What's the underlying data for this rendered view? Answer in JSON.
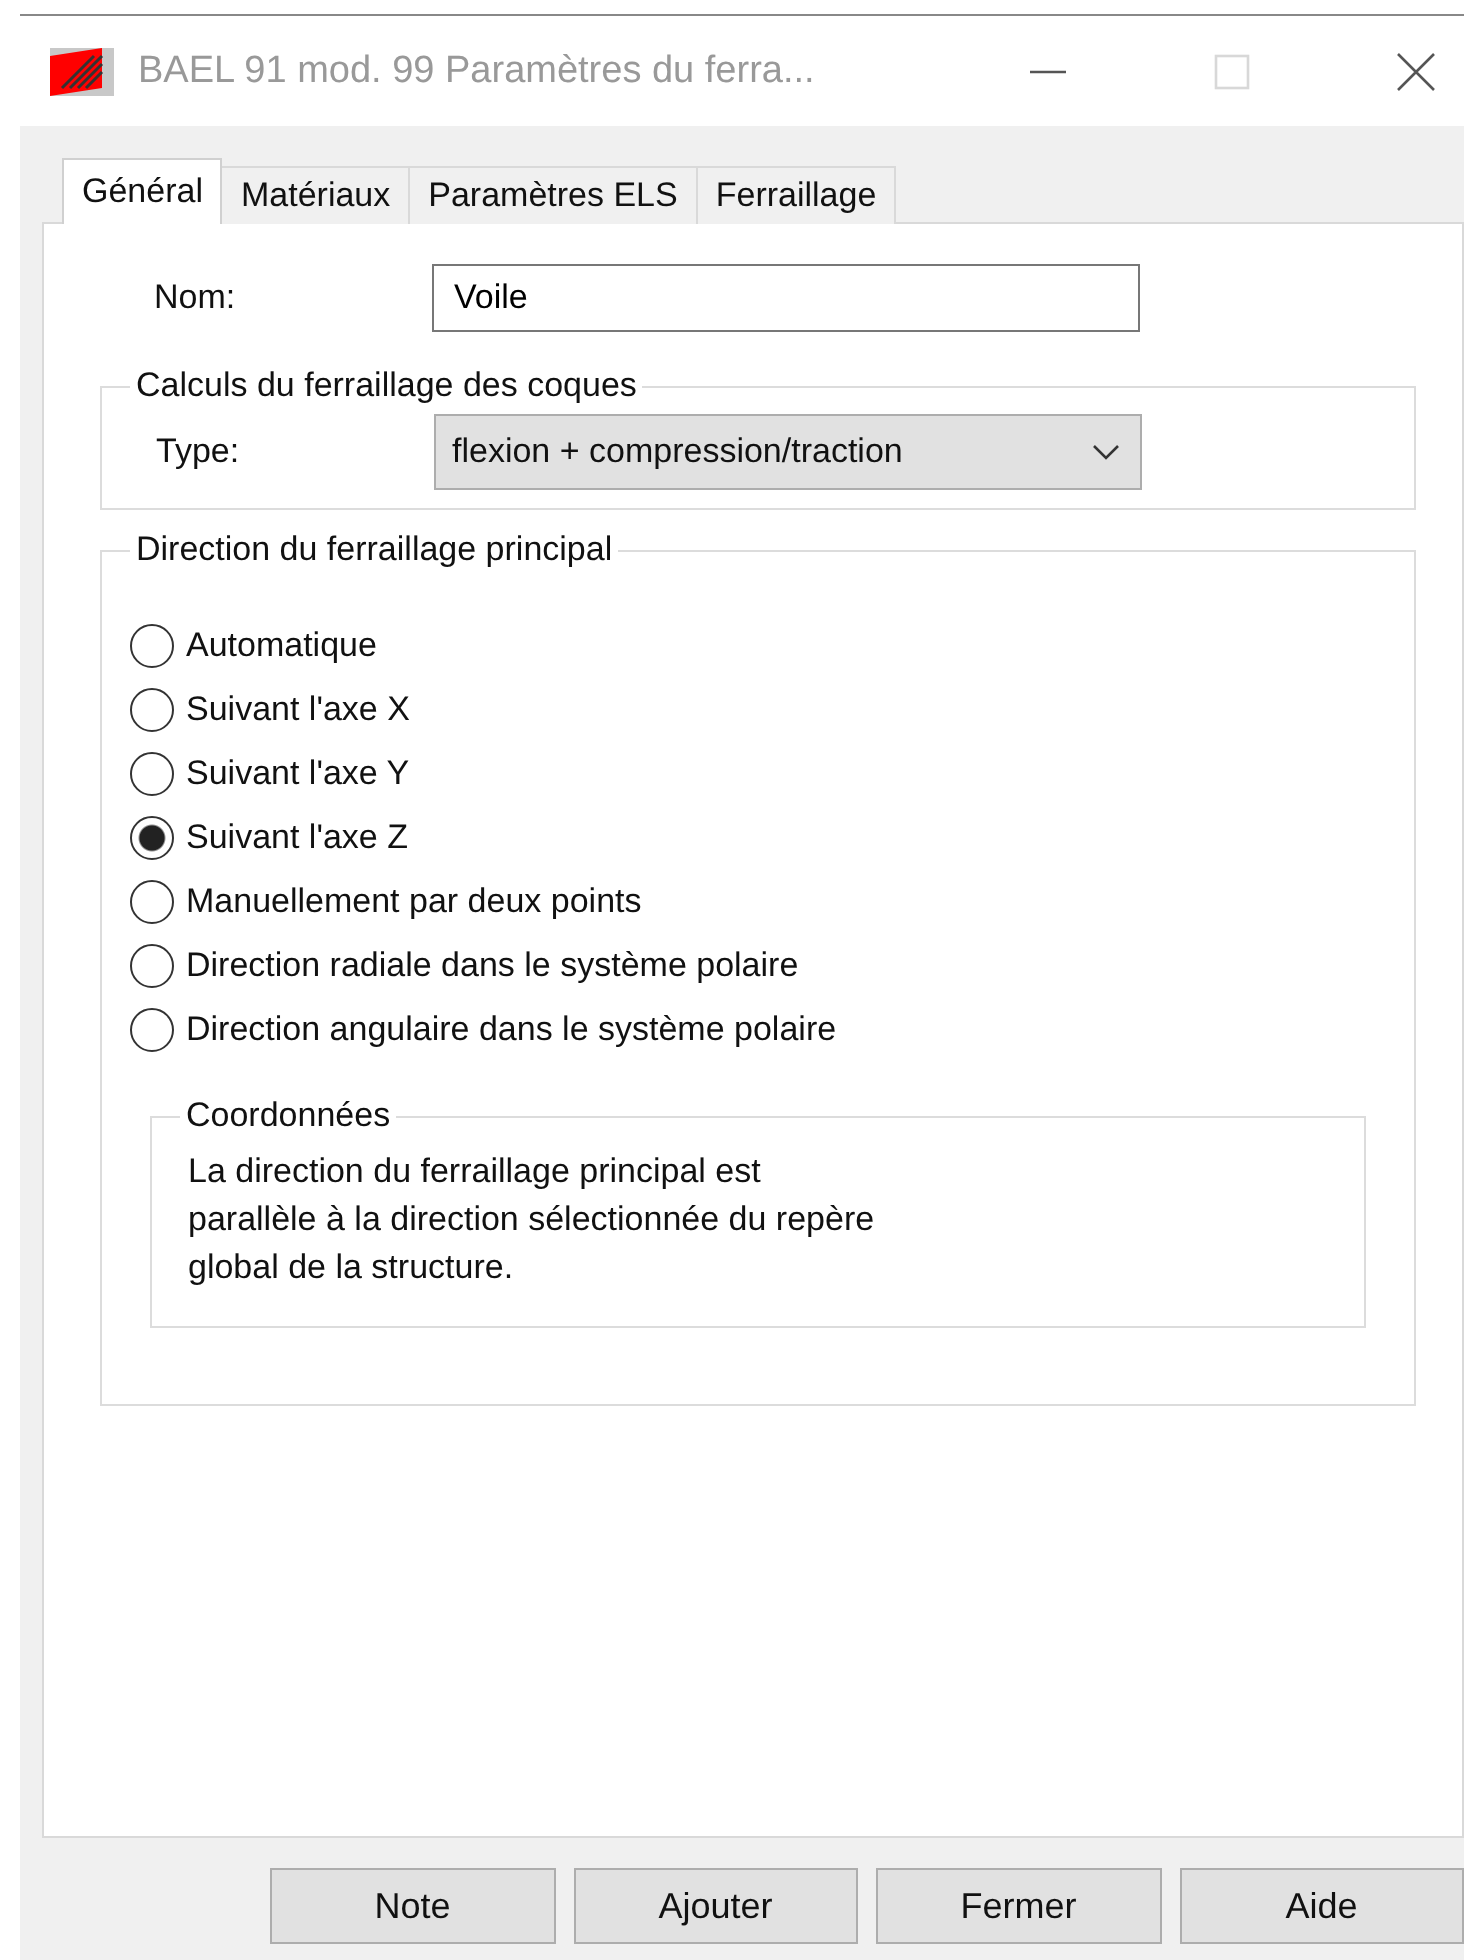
{
  "window": {
    "title": "BAEL 91 mod. 99 Paramètres du ferra...",
    "maximize_disabled": true
  },
  "tabs": [
    {
      "label": "Général",
      "selected": true
    },
    {
      "label": "Matériaux",
      "selected": false
    },
    {
      "label": "Paramètres ELS",
      "selected": false
    },
    {
      "label": "Ferraillage",
      "selected": false
    }
  ],
  "name_field": {
    "label": "Nom:",
    "value": "Voile"
  },
  "shell_calc": {
    "title": "Calculs du ferraillage des coques",
    "type_label": "Type:",
    "type_value": "flexion + compression/traction"
  },
  "direction": {
    "title": "Direction du ferraillage principal",
    "options": [
      {
        "label": "Automatique",
        "selected": false
      },
      {
        "label": "Suivant l'axe X",
        "selected": false
      },
      {
        "label": "Suivant l'axe Y",
        "selected": false
      },
      {
        "label": "Suivant l'axe Z",
        "selected": true
      },
      {
        "label": "Manuellement par deux points",
        "selected": false
      },
      {
        "label": "Direction radiale dans le système polaire",
        "selected": false
      },
      {
        "label": "Direction angulaire dans le système polaire",
        "selected": false
      }
    ],
    "coordinates": {
      "title": "Coordonnées",
      "lines": [
        "La direction du ferraillage principal est",
        "parallèle à la direction sélectionnée du repère",
        "global de la structure."
      ]
    }
  },
  "buttons": [
    "Note",
    "Ajouter",
    "Fermer",
    "Aide"
  ]
}
